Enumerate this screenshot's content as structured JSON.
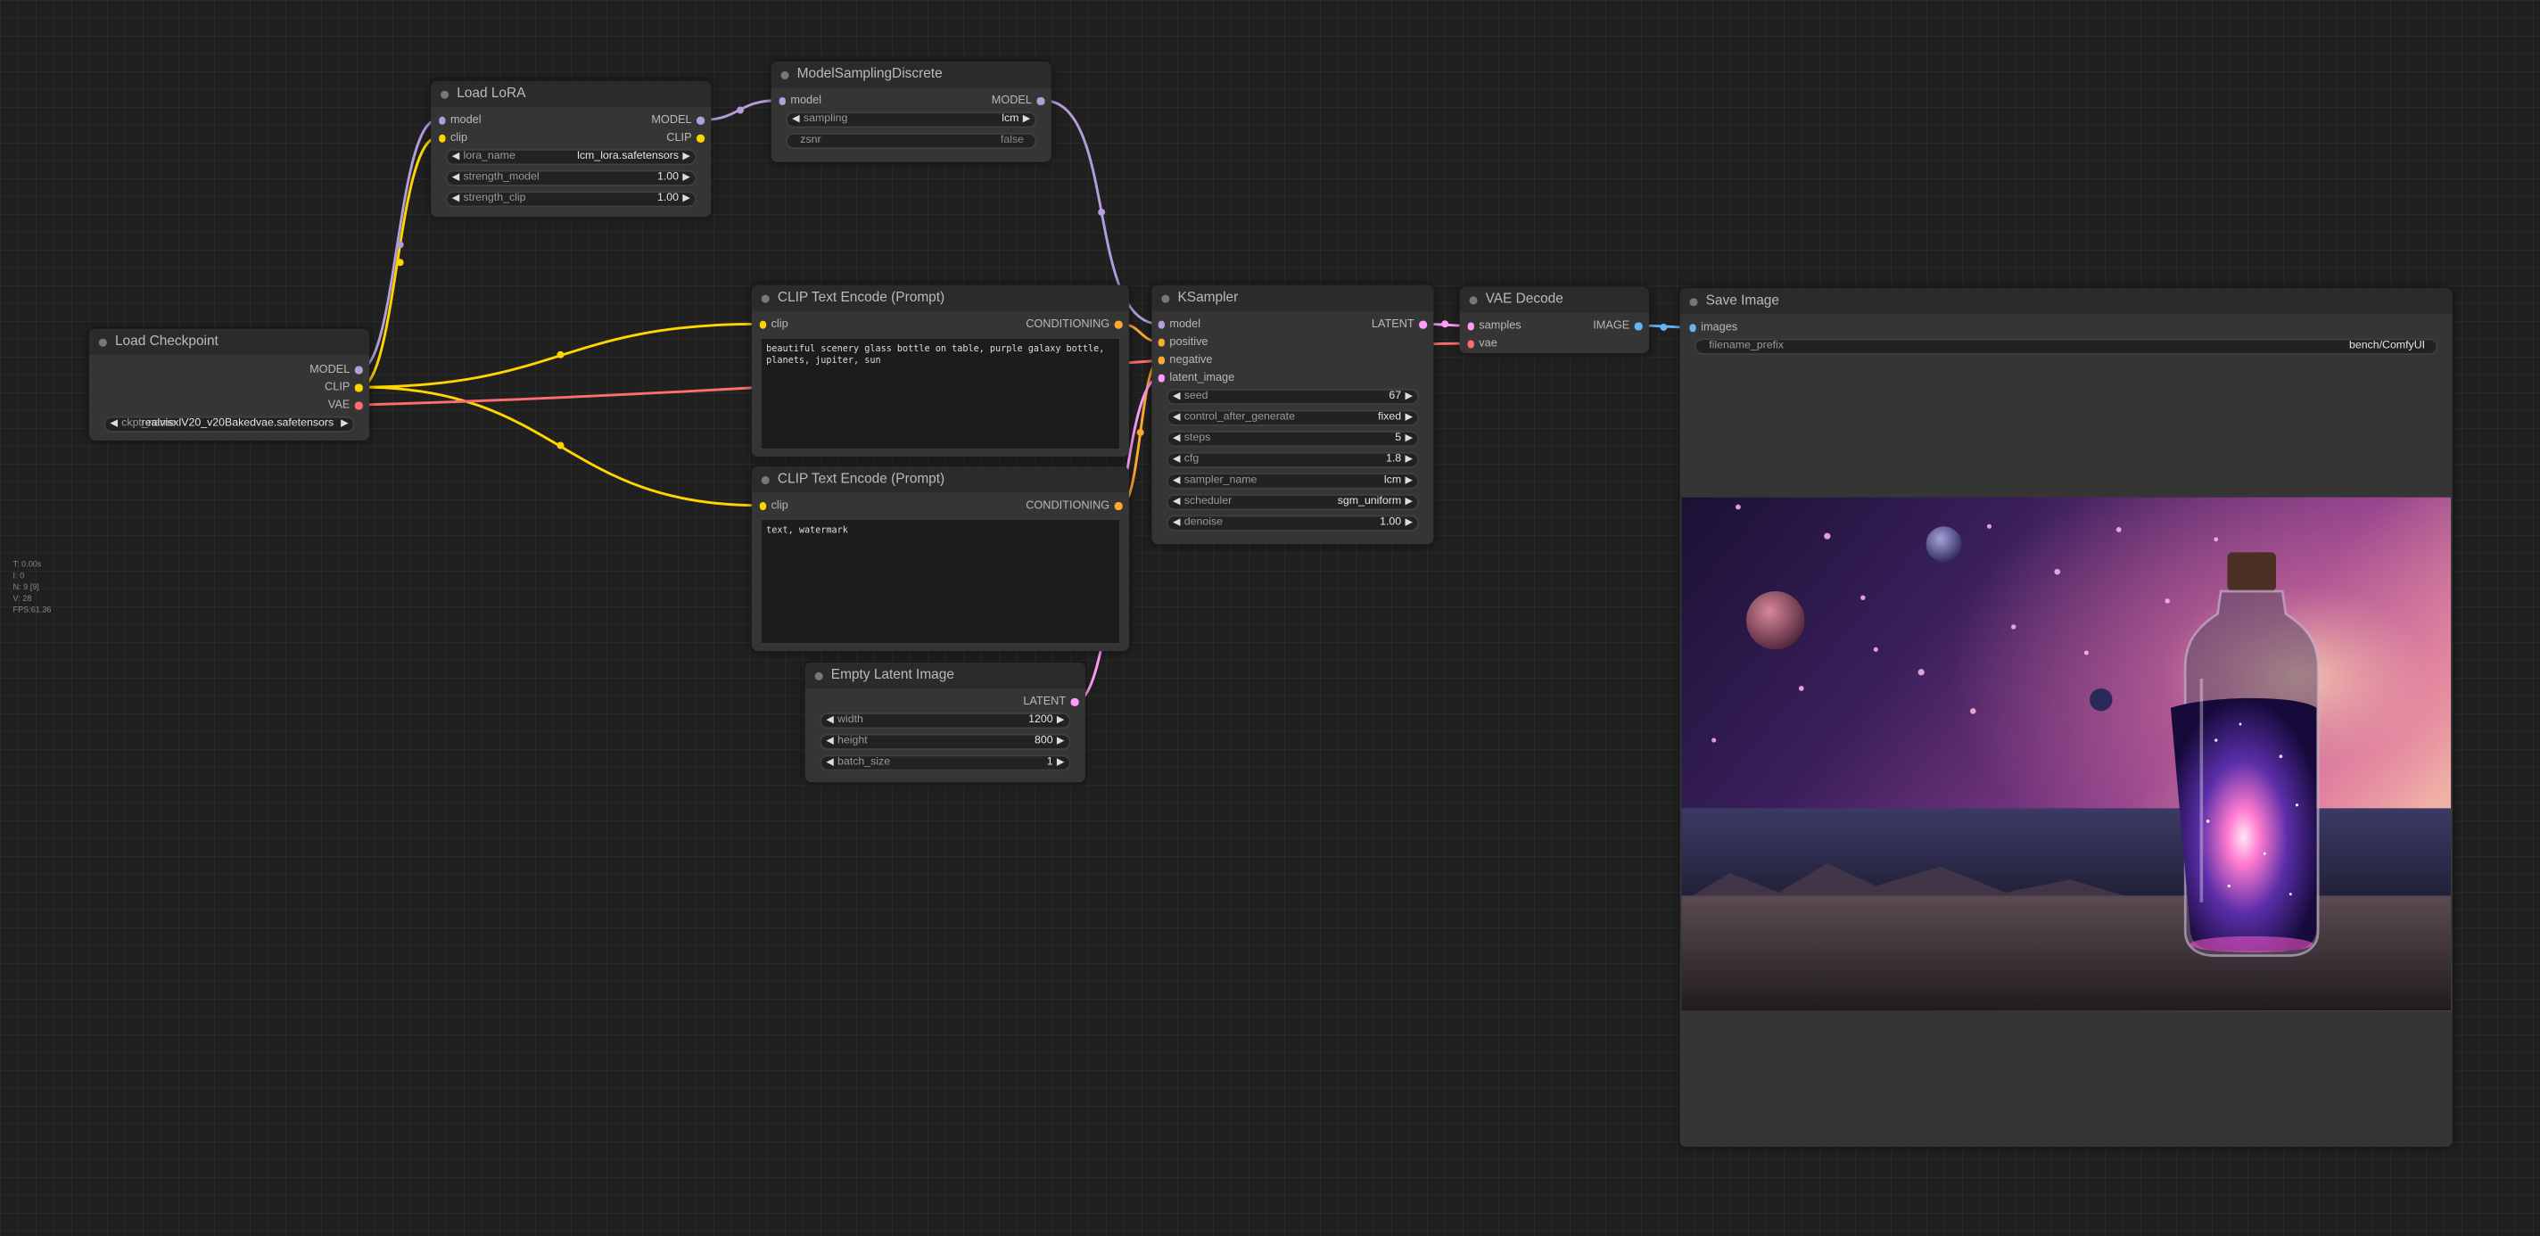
{
  "stats": [
    "T: 0.00s",
    "I: 0",
    "N: 9 [9]",
    "V: 28",
    "FPS:61.36"
  ],
  "colors": {
    "model": "#b39ddb",
    "clip": "#ffd500",
    "vae": "#ff6e6e",
    "conditioning": "#ffa931",
    "latent": "#ff9cf9",
    "image": "#64b5f6"
  },
  "nodes": {
    "load_lora": {
      "title": "Load LoRA",
      "inputs": [
        "model",
        "clip"
      ],
      "outputs": [
        "MODEL",
        "CLIP"
      ],
      "widgets": [
        {
          "label": "lora_name",
          "value": "lcm_lora.safetensors"
        },
        {
          "label": "strength_model",
          "value": "1.00"
        },
        {
          "label": "strength_clip",
          "value": "1.00"
        }
      ]
    },
    "model_sampling": {
      "title": "ModelSamplingDiscrete",
      "inputs": [
        "model"
      ],
      "outputs": [
        "MODEL"
      ],
      "widgets": [
        {
          "label": "sampling",
          "value": "lcm"
        },
        {
          "label": "zsnr",
          "value": "false"
        }
      ]
    },
    "load_checkpoint": {
      "title": "Load Checkpoint",
      "outputs": [
        "MODEL",
        "CLIP",
        "VAE"
      ],
      "widgets": [
        {
          "label": "ckpt_name",
          "value": "realvisxlV20_v20Bakedvae.safetensors"
        }
      ]
    },
    "clip_pos": {
      "title": "CLIP Text Encode (Prompt)",
      "inputs": [
        "clip"
      ],
      "outputs": [
        "CONDITIONING"
      ],
      "text": "beautiful scenery glass bottle on table, purple galaxy bottle,\nplanets, jupiter, sun"
    },
    "clip_neg": {
      "title": "CLIP Text Encode (Prompt)",
      "inputs": [
        "clip"
      ],
      "outputs": [
        "CONDITIONING"
      ],
      "text": "text, watermark"
    },
    "ksampler": {
      "title": "KSampler",
      "inputs": [
        "model",
        "positive",
        "negative",
        "latent_image"
      ],
      "outputs": [
        "LATENT"
      ],
      "widgets": [
        {
          "label": "seed",
          "value": "67"
        },
        {
          "label": "control_after_generate",
          "value": "fixed"
        },
        {
          "label": "steps",
          "value": "5"
        },
        {
          "label": "cfg",
          "value": "1.8"
        },
        {
          "label": "sampler_name",
          "value": "lcm"
        },
        {
          "label": "scheduler",
          "value": "sgm_uniform"
        },
        {
          "label": "denoise",
          "value": "1.00"
        }
      ]
    },
    "vae_decode": {
      "title": "VAE Decode",
      "inputs": [
        "samples",
        "vae"
      ],
      "outputs": [
        "IMAGE"
      ]
    },
    "save_image": {
      "title": "Save Image",
      "inputs": [
        "images"
      ],
      "widgets": [
        {
          "label": "filename_prefix",
          "value": "bench/ComfyUI"
        }
      ]
    },
    "empty_latent": {
      "title": "Empty Latent Image",
      "outputs": [
        "LATENT"
      ],
      "widgets": [
        {
          "label": "width",
          "value": "1200"
        },
        {
          "label": "height",
          "value": "800"
        },
        {
          "label": "batch_size",
          "value": "1"
        }
      ]
    }
  }
}
